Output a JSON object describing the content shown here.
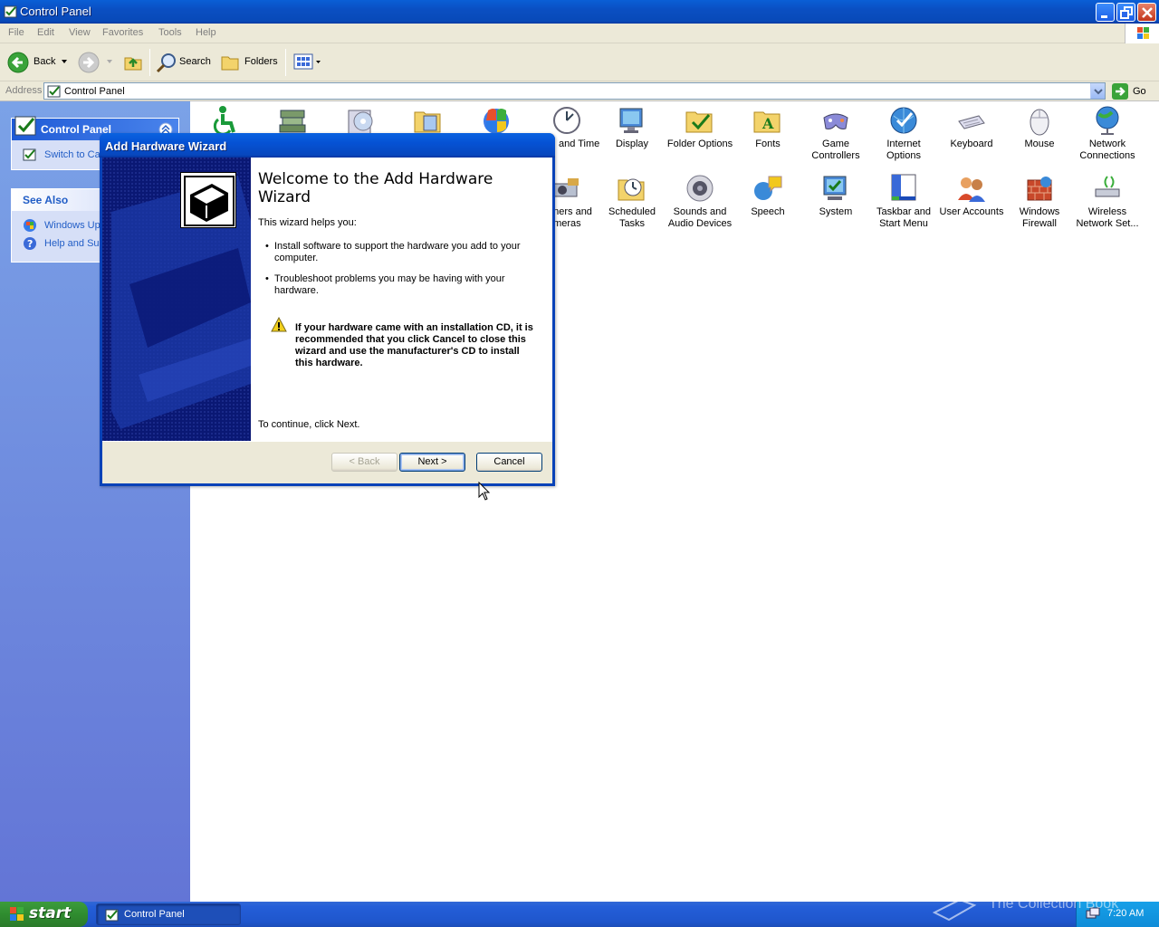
{
  "window": {
    "title": "Control Panel"
  },
  "menu": [
    "File",
    "Edit",
    "View",
    "Favorites",
    "Tools",
    "Help"
  ],
  "toolbar": {
    "back": "Back",
    "search": "Search",
    "folders": "Folders"
  },
  "address": {
    "label": "Address",
    "value": "Control Panel",
    "go": "Go"
  },
  "taskpane": {
    "control_panel": {
      "title": "Control Panel",
      "items": [
        "Switch to Category View"
      ]
    },
    "see_also": {
      "title": "See Also",
      "items": [
        "Windows Update",
        "Help and Support"
      ]
    }
  },
  "icons_row1": [
    {
      "label": "",
      "icon": "accessibility-icon"
    },
    {
      "label": "",
      "icon": "add-hardware-icon"
    },
    {
      "label": "",
      "icon": "add-remove-programs-icon"
    },
    {
      "label": "",
      "icon": "admin-tools-icon"
    },
    {
      "label": "",
      "icon": "automatic-updates-icon"
    },
    {
      "label": "and Time",
      "icon": "date-time-icon"
    },
    {
      "label": "Display",
      "icon": "display-icon"
    },
    {
      "label": "Folder Options",
      "icon": "folder-options-icon"
    },
    {
      "label": "Fonts",
      "icon": "fonts-icon"
    },
    {
      "label": "Game Controllers",
      "icon": "game-controllers-icon"
    },
    {
      "label": "Internet Options",
      "icon": "internet-options-icon"
    },
    {
      "label": "Keyboard",
      "icon": "keyboard-icon"
    },
    {
      "label": "Mouse",
      "icon": "mouse-icon"
    },
    {
      "label": "Network Connections",
      "icon": "network-connections-icon"
    }
  ],
  "icons_row2": [
    {
      "label": "nners and ameras",
      "icon": "scanners-cameras-icon"
    },
    {
      "label": "Scheduled Tasks",
      "icon": "scheduled-tasks-icon"
    },
    {
      "label": "Sounds and Audio Devices",
      "icon": "sounds-icon"
    },
    {
      "label": "Speech",
      "icon": "speech-icon"
    },
    {
      "label": "System",
      "icon": "system-icon"
    },
    {
      "label": "Taskbar and Start Menu",
      "icon": "taskbar-icon"
    },
    {
      "label": "User Accounts",
      "icon": "user-accounts-icon"
    },
    {
      "label": "Windows Firewall",
      "icon": "firewall-icon"
    },
    {
      "label": "Wireless Network Set...",
      "icon": "wireless-icon"
    }
  ],
  "dialog": {
    "title": "Add Hardware Wizard",
    "heading": "Welcome to the Add Hardware Wizard",
    "intro": "This wizard helps you:",
    "bullets": [
      "Install software to support the hardware you add to your computer.",
      "Troubleshoot problems you may be having with your hardware."
    ],
    "warning": "If your hardware came with an installation CD, it is recommended that you click Cancel to close this wizard and use the manufacturer's CD to install this hardware.",
    "continue": "To continue, click Next.",
    "back": "< Back",
    "next": "Next >",
    "cancel": "Cancel"
  },
  "taskbar": {
    "start": "start",
    "item": "Control Panel",
    "clock": "7:20 AM",
    "watermark": "The Collection Book"
  }
}
